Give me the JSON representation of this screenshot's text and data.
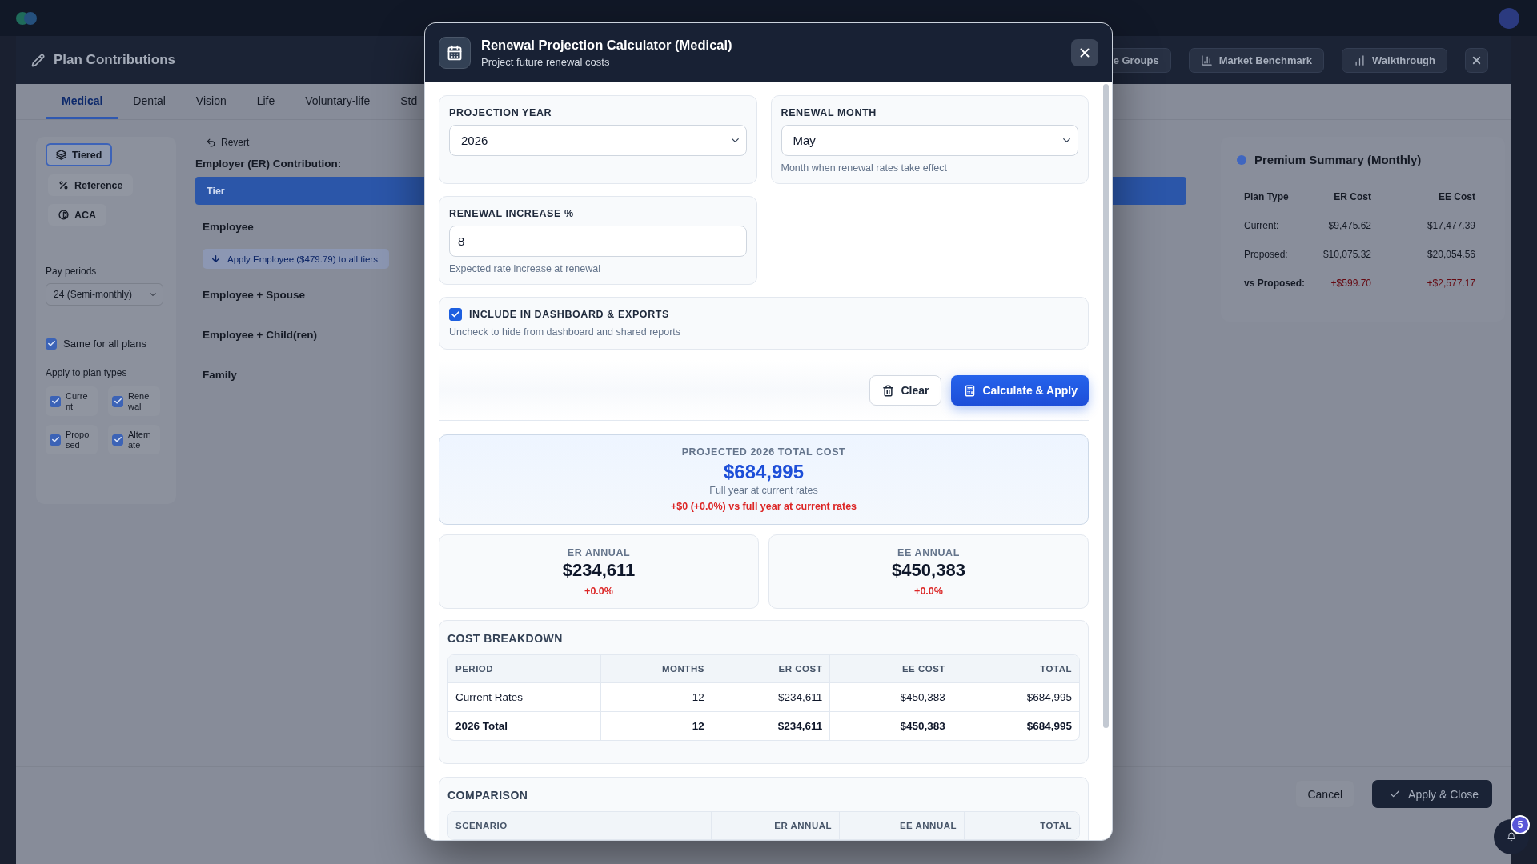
{
  "app": {
    "title": "Plan Contributions",
    "header_buttons": [
      {
        "kind": "groups",
        "label": "e Groups"
      },
      {
        "kind": "benchmark",
        "label": "Market Benchmark"
      },
      {
        "kind": "walkthrough",
        "label": "Walkthrough"
      }
    ],
    "tabs": [
      {
        "label": "Medical",
        "selected": true
      },
      {
        "label": "Dental",
        "selected": false
      },
      {
        "label": "Vision",
        "selected": false
      },
      {
        "label": "Life",
        "selected": false
      },
      {
        "label": "Voluntary-life",
        "selected": false
      },
      {
        "label": "Std",
        "selected": false
      }
    ],
    "modes": [
      {
        "kind": "tiered",
        "label": "Tiered",
        "selected": true
      },
      {
        "kind": "reference",
        "label": "Reference",
        "selected": false
      },
      {
        "kind": "aca",
        "label": "ACA",
        "selected": false
      }
    ],
    "pay_periods": {
      "label": "Pay periods",
      "value": "24 (Semi-monthly)"
    },
    "same_for_all": {
      "label": "Same for all plans",
      "checked": true
    },
    "plan_types": {
      "label": "Apply to plan types",
      "items": [
        {
          "label": "Current",
          "checked": true
        },
        {
          "label": "Renewal",
          "checked": true
        },
        {
          "label": "Proposed",
          "checked": true
        },
        {
          "label": "Alternate",
          "checked": true
        }
      ]
    },
    "revert": "Revert",
    "contribution": {
      "title": "Employer (ER) Contribution:",
      "column": "Tier",
      "rows": [
        {
          "kind": "tier",
          "label": "Employee"
        },
        {
          "kind": "action",
          "label": "Apply Employee ($479.79) to all tiers"
        },
        {
          "kind": "tier",
          "label": "Employee + Spouse"
        },
        {
          "kind": "tier",
          "label": "Employee + Child(ren)"
        },
        {
          "kind": "tier",
          "label": "Family"
        }
      ]
    },
    "premium_summary": {
      "title": "Premium Summary (Monthly)",
      "columns": [
        "Plan Type",
        "ER Cost",
        "EE Cost"
      ],
      "rows": [
        {
          "kind": "plain",
          "label": "Current:",
          "er": "$9,475.62",
          "ee": "$17,477.39"
        },
        {
          "kind": "plain",
          "label": "Proposed:",
          "er": "$10,075.32",
          "ee": "$20,054.56"
        },
        {
          "kind": "delta",
          "label": "vs Proposed:",
          "er": "+$599.70",
          "ee": "+$2,577.17"
        }
      ]
    },
    "footer_buttons": [
      {
        "kind": "secondary",
        "label": "Cancel"
      },
      {
        "kind": "primary",
        "label": "Apply & Close"
      }
    ],
    "notifications": {
      "count": "5"
    }
  },
  "modal": {
    "title": "Renewal Projection Calculator (Medical)",
    "subtitle": "Project future renewal costs",
    "fields": [
      {
        "kind": "select",
        "label": "PROJECTION YEAR",
        "value": "2026"
      },
      {
        "kind": "select",
        "label": "RENEWAL MONTH",
        "value": "May",
        "hint": "Month when renewal rates take effect"
      },
      {
        "kind": "input",
        "label": "RENEWAL INCREASE %",
        "value": "8",
        "hint": "Expected rate increase at renewal"
      }
    ],
    "include": {
      "label": "INCLUDE IN DASHBOARD & EXPORTS",
      "checked": true,
      "hint": "Uncheck to hide from dashboard and shared reports"
    },
    "actions": [
      {
        "kind": "secondary",
        "label": "Clear"
      },
      {
        "kind": "primary",
        "label": "Calculate & Apply"
      }
    ],
    "projection": {
      "label": "PROJECTED 2026 TOTAL COST",
      "amount": "$684,995",
      "note": "Full year at current rates",
      "change": "+$0 (+0.0%) vs full year at current rates"
    },
    "annual": [
      {
        "label": "ER ANNUAL",
        "amount": "$234,611",
        "change": "+0.0%"
      },
      {
        "label": "EE ANNUAL",
        "amount": "$450,383",
        "change": "+0.0%"
      }
    ],
    "cost_breakdown": {
      "title": "COST BREAKDOWN",
      "columns": [
        "PERIOD",
        "MONTHS",
        "ER COST",
        "EE COST",
        "TOTAL"
      ],
      "rows": [
        {
          "kind": "plain",
          "cells": [
            "Current Rates",
            "12",
            "$234,611",
            "$450,383",
            "$684,995"
          ]
        },
        {
          "kind": "total",
          "cells": [
            "2026 Total",
            "12",
            "$234,611",
            "$450,383",
            "$684,995"
          ]
        }
      ]
    },
    "comparison": {
      "title": "COMPARISON",
      "columns": [
        "SCENARIO",
        "ER ANNUAL",
        "EE ANNUAL",
        "TOTAL"
      ]
    }
  }
}
